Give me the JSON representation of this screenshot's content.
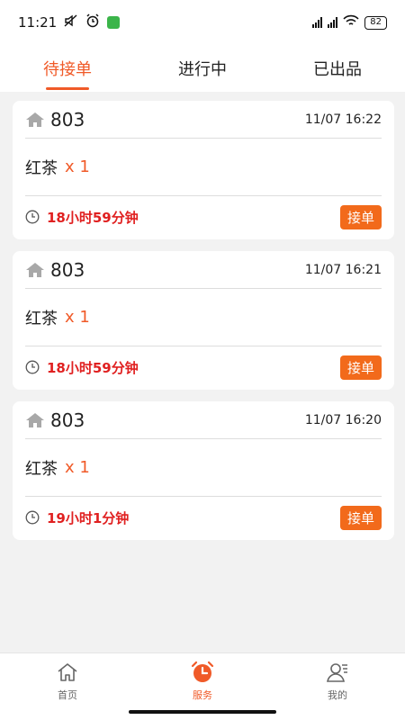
{
  "status_bar": {
    "time": "11:21",
    "battery": "82"
  },
  "tabs": [
    {
      "label": "待接单",
      "active": true
    },
    {
      "label": "进行中",
      "active": false
    },
    {
      "label": "已出品",
      "active": false
    }
  ],
  "orders": [
    {
      "room": "803",
      "time": "11/07 16:22",
      "item": "红茶",
      "qty": "x 1",
      "remaining": "18小时59分钟",
      "action": "接单"
    },
    {
      "room": "803",
      "time": "11/07 16:21",
      "item": "红茶",
      "qty": "x 1",
      "remaining": "18小时59分钟",
      "action": "接单"
    },
    {
      "room": "803",
      "time": "11/07 16:20",
      "item": "红茶",
      "qty": "x 1",
      "remaining": "19小时1分钟",
      "action": "接单"
    }
  ],
  "bottom_nav": [
    {
      "label": "首页",
      "icon": "home-icon",
      "active": false
    },
    {
      "label": "服务",
      "icon": "alarm-clock-icon",
      "active": true
    },
    {
      "label": "我的",
      "icon": "user-icon",
      "active": false
    }
  ],
  "colors": {
    "accent": "#f05a28",
    "button": "#f26a1b",
    "remaining_text": "#e02020"
  }
}
